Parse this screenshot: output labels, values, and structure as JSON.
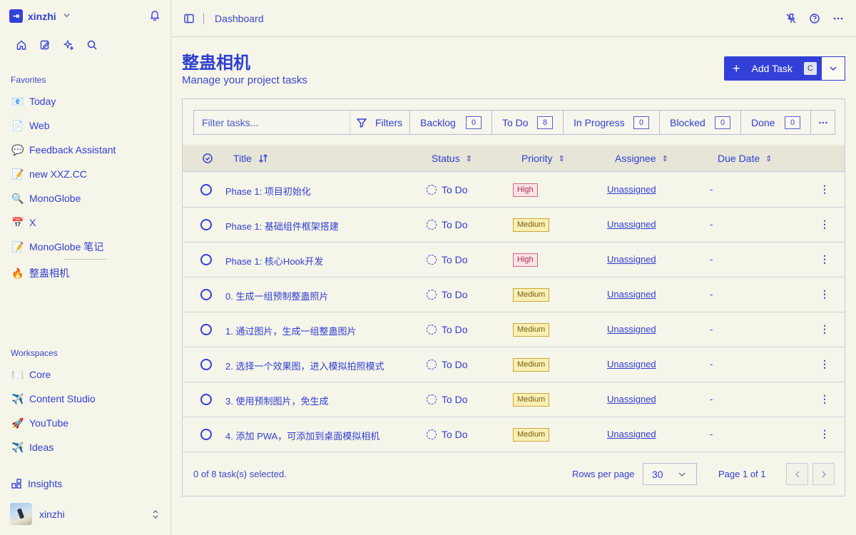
{
  "workspace": {
    "name": "xinzhi",
    "logo_glyph": "⇥"
  },
  "sidebar": {
    "favorites_label": "Favorites",
    "favorites": [
      {
        "emoji": "📧",
        "label": "Today"
      },
      {
        "emoji": "📄",
        "label": "Web"
      },
      {
        "emoji": "💬",
        "label": "Feedback Assistant"
      },
      {
        "emoji": "📝",
        "label": "new XXZ.CC"
      },
      {
        "emoji": "🔍",
        "label": "MonoGlobe"
      },
      {
        "emoji": "📅",
        "label": "X"
      },
      {
        "emoji": "📝",
        "label": "MonoGlobe 笔记"
      },
      {
        "emoji": "🔥",
        "label": "整蛊相机"
      }
    ],
    "workspaces_label": "Workspaces",
    "workspaces": [
      {
        "emoji": "🍽️",
        "label": "Core"
      },
      {
        "emoji": "✈️",
        "label": "Content Studio"
      },
      {
        "emoji": "🚀",
        "label": "YouTube"
      },
      {
        "emoji": "✈️",
        "label": "Ideas"
      }
    ],
    "insights_label": "Insights",
    "user_name": "xinzhi"
  },
  "topbar": {
    "breadcrumb": "Dashboard"
  },
  "page": {
    "title": "整蛊相机",
    "subtitle": "Manage your project tasks",
    "add_task_label": "Add Task",
    "add_task_shortcut": "C"
  },
  "toolbar": {
    "filter_placeholder": "Filter tasks...",
    "filters_label": "Filters",
    "statuses": [
      {
        "label": "Backlog",
        "count": "0"
      },
      {
        "label": "To Do",
        "count": "8"
      },
      {
        "label": "In Progress",
        "count": "0"
      },
      {
        "label": "Blocked",
        "count": "0"
      },
      {
        "label": "Done",
        "count": "0"
      }
    ]
  },
  "table": {
    "headers": {
      "title": "Title",
      "status": "Status",
      "priority": "Priority",
      "assignee": "Assignee",
      "due": "Due Date"
    },
    "rows": [
      {
        "title": "Phase 1: 项目初始化",
        "status": "To Do",
        "priority": "High",
        "assignee": "Unassigned",
        "due": "-"
      },
      {
        "title": "Phase 1: 基础组件框架搭建",
        "status": "To Do",
        "priority": "Medium",
        "assignee": "Unassigned",
        "due": "-"
      },
      {
        "title": "Phase 1: 核心Hook开发",
        "status": "To Do",
        "priority": "High",
        "assignee": "Unassigned",
        "due": "-"
      },
      {
        "title": "0. 生成一组预制整蛊照片",
        "status": "To Do",
        "priority": "Medium",
        "assignee": "Unassigned",
        "due": "-"
      },
      {
        "title": "1. 通过图片，生成一组整蛊图片",
        "status": "To Do",
        "priority": "Medium",
        "assignee": "Unassigned",
        "due": "-"
      },
      {
        "title": "2. 选择一个效果图，进入模拟拍照模式",
        "status": "To Do",
        "priority": "Medium",
        "assignee": "Unassigned",
        "due": "-"
      },
      {
        "title": "3. 使用预制图片，免生成",
        "status": "To Do",
        "priority": "Medium",
        "assignee": "Unassigned",
        "due": "-"
      },
      {
        "title": "4. 添加 PWA，可添加到桌面模拟相机",
        "status": "To Do",
        "priority": "Medium",
        "assignee": "Unassigned",
        "due": "-"
      }
    ]
  },
  "footer": {
    "selection_text": "0 of 8 task(s) selected.",
    "rows_per_page_label": "Rows per page",
    "rows_per_page_value": "30",
    "page_info": "Page 1 of 1"
  },
  "colors": {
    "accent": "#3340d8",
    "background": "#f6f5ea",
    "high_bg": "#fbe3e7",
    "medium_bg": "#fbefb4"
  }
}
